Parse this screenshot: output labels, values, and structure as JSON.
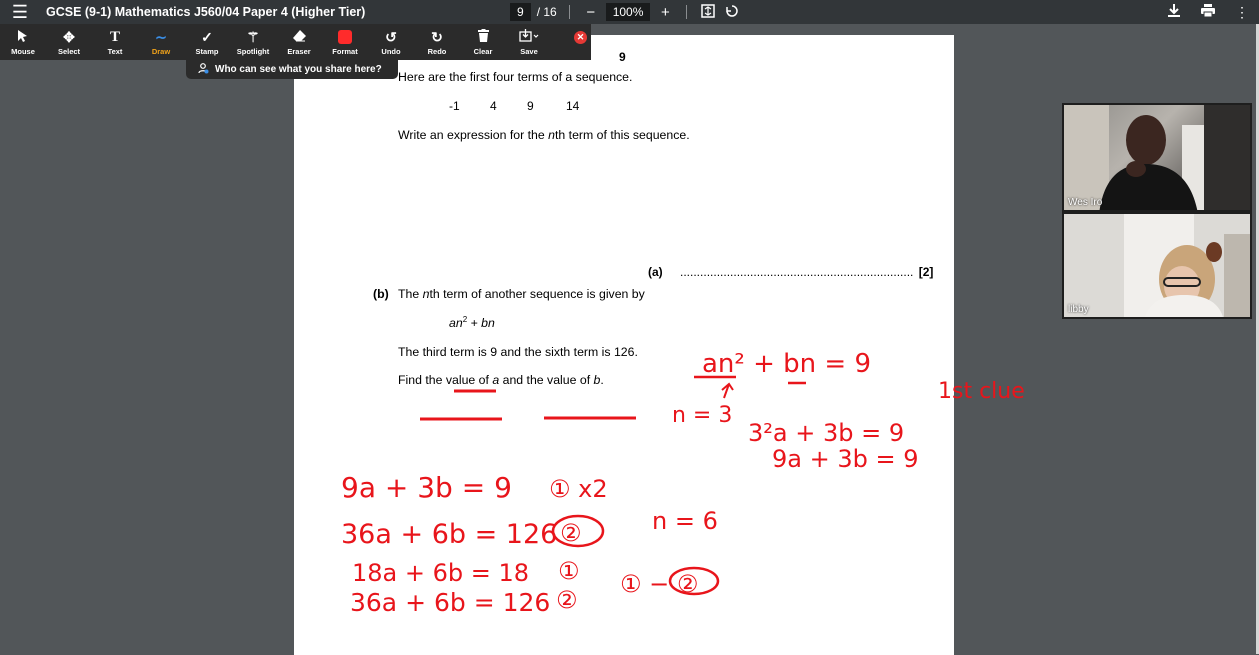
{
  "app": {
    "doc_title": "GCSE (9-1) Mathematics J560/04 Paper 4 (Higher Tier)",
    "current_page": "9",
    "total_pages": "/ 16",
    "zoom": "100%",
    "zoom_out": "−",
    "zoom_in": "+"
  },
  "toolbar": {
    "tools": [
      {
        "label": "Mouse",
        "icon": "cursor-icon"
      },
      {
        "label": "Select",
        "icon": "move-icon"
      },
      {
        "label": "Text",
        "icon": "text-icon"
      },
      {
        "label": "Draw",
        "icon": "draw-icon"
      },
      {
        "label": "Stamp",
        "icon": "check-icon"
      },
      {
        "label": "Spotlight",
        "icon": "wand-icon"
      },
      {
        "label": "Eraser",
        "icon": "eraser-icon"
      },
      {
        "label": "Format",
        "icon": "color-swatch-icon"
      },
      {
        "label": "Undo",
        "icon": "undo-icon"
      },
      {
        "label": "Redo",
        "icon": "redo-icon"
      },
      {
        "label": "Clear",
        "icon": "trash-icon"
      },
      {
        "label": "Save",
        "icon": "save-icon"
      }
    ],
    "active_tool": "Draw",
    "share_tip": "Who can see what you share here?"
  },
  "page": {
    "page_number": "9",
    "part_a_label": "(a)",
    "part_a_intro": "Here are the first four terms of a sequence.",
    "sequence": [
      "-1",
      "4",
      "9",
      "14"
    ],
    "part_a_task_pre": "Write an expression for the ",
    "part_a_task_n": "n",
    "part_a_task_post": "th term of this sequence.",
    "answer_label": "(a)",
    "answer_dots": "......................................................................",
    "answer_marks": "[2]",
    "part_b_label": "(b)",
    "part_b_intro_pre": "The ",
    "part_b_intro_n": "n",
    "part_b_intro_post": "th term of another sequence is given by",
    "expr_a": "an",
    "expr_sup": "2",
    "expr_rest": " + bn",
    "part_b_given": "The third term is 9 and the sixth term is 126.",
    "part_b_task_pre": "Find the value of ",
    "part_b_task_a": "a",
    "part_b_task_mid": " and the value of ",
    "part_b_task_b": "b",
    "part_b_task_end": "."
  },
  "participants": [
    {
      "name": "Wes Iro"
    },
    {
      "name": "libby"
    }
  ],
  "annotations": {
    "eq_top": "an² + bn = 9",
    "first_clue": "1st clue",
    "n3": "n = 3",
    "sub1": "3²a + 3b = 9",
    "sub2": "9a + 3b = 9",
    "l1": "9a + 3b = 9",
    "l1_tag": "① x2",
    "l2": "36a + 6b = 126",
    "l2_tag": "②",
    "n6": "n = 6",
    "l3": "18a + 6b = 18",
    "l3_tag": "①",
    "l4": "36a + 6b = 126",
    "l4_tag": "②",
    "diff": "① − ②"
  },
  "colors": {
    "ink": "#e8151b",
    "toolbar_bg": "#2b2b2b",
    "topbar_bg": "#323639",
    "viewer_bg": "#525659",
    "active_tool": "#f0a21a"
  }
}
